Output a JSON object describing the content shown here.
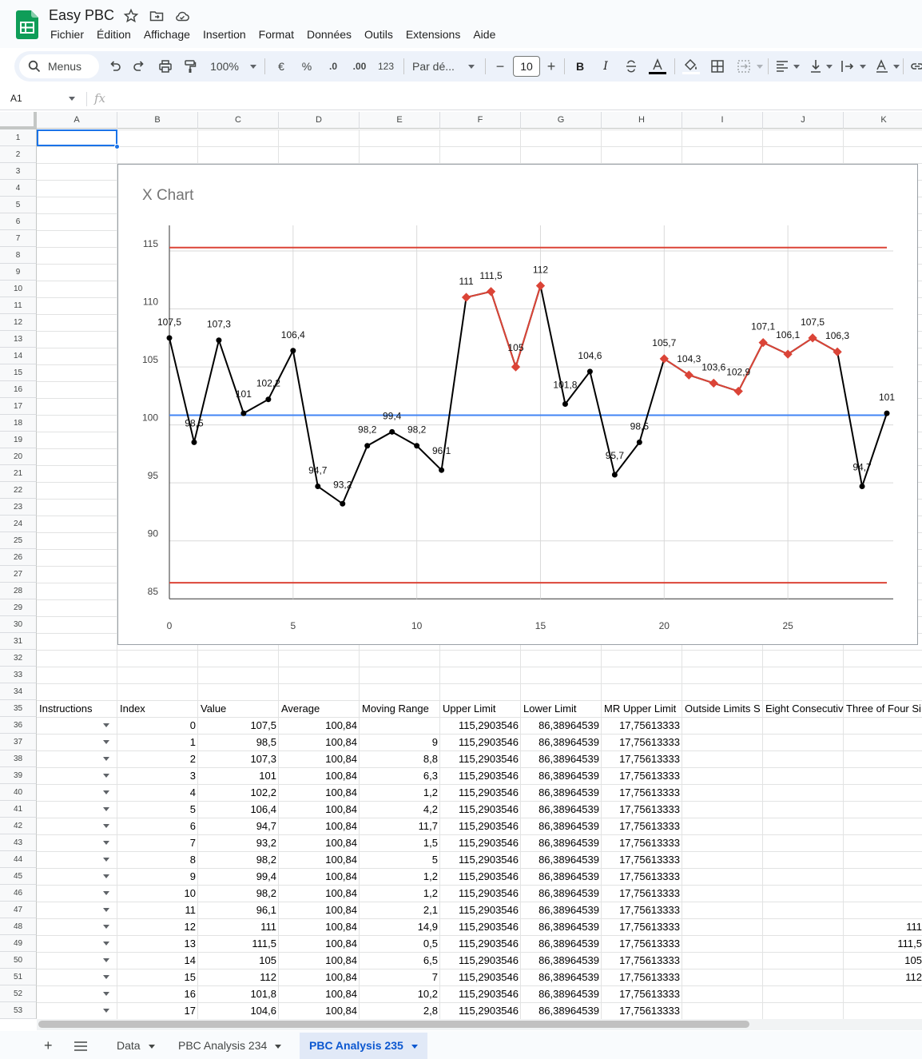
{
  "app": {
    "title": "Easy PBC",
    "menus": [
      "Fichier",
      "Édition",
      "Affichage",
      "Insertion",
      "Format",
      "Données",
      "Outils",
      "Extensions",
      "Aide"
    ]
  },
  "toolbar": {
    "search_label": "Menus",
    "zoom": "100%",
    "currency": "€",
    "percent": "%",
    "dec_decrease": ".0",
    "dec_increase": ".00",
    "number_format": "123",
    "font": "Par dé...",
    "font_size": "10",
    "bold": "B",
    "italic": "I"
  },
  "formula_bar": {
    "name_box": "A1",
    "fx": "fx"
  },
  "columns": [
    "A",
    "B",
    "C",
    "D",
    "E",
    "F",
    "G",
    "H",
    "I",
    "J",
    "K"
  ],
  "rows": [
    "1",
    "2",
    "3",
    "4",
    "5",
    "6",
    "7",
    "8",
    "9",
    "10",
    "11",
    "12",
    "13",
    "14",
    "15",
    "16",
    "17",
    "18",
    "19",
    "20",
    "21",
    "22",
    "23",
    "24",
    "25",
    "26",
    "27",
    "28",
    "29",
    "30",
    "31",
    "32",
    "33",
    "34",
    "35",
    "36",
    "37",
    "38",
    "39",
    "40",
    "41",
    "42",
    "43",
    "44",
    "45",
    "46",
    "47",
    "48",
    "49",
    "50",
    "51",
    "52",
    "53"
  ],
  "table": {
    "headers": [
      "Instructions",
      "Index",
      "Value",
      "Average",
      "Moving Range",
      "Upper Limit",
      "Lower Limit",
      "MR Upper Limit",
      "Outside Limits S",
      "Eight Consecutiv",
      "Three of Four Si"
    ],
    "rows": [
      [
        "",
        "0",
        "107,5",
        "100,84",
        "",
        "115,2903546",
        "86,38964539",
        "17,75613333",
        "",
        "",
        ""
      ],
      [
        "",
        "1",
        "98,5",
        "100,84",
        "9",
        "115,2903546",
        "86,38964539",
        "17,75613333",
        "",
        "",
        ""
      ],
      [
        "",
        "2",
        "107,3",
        "100,84",
        "8,8",
        "115,2903546",
        "86,38964539",
        "17,75613333",
        "",
        "",
        ""
      ],
      [
        "",
        "3",
        "101",
        "100,84",
        "6,3",
        "115,2903546",
        "86,38964539",
        "17,75613333",
        "",
        "",
        ""
      ],
      [
        "",
        "4",
        "102,2",
        "100,84",
        "1,2",
        "115,2903546",
        "86,38964539",
        "17,75613333",
        "",
        "",
        ""
      ],
      [
        "",
        "5",
        "106,4",
        "100,84",
        "4,2",
        "115,2903546",
        "86,38964539",
        "17,75613333",
        "",
        "",
        ""
      ],
      [
        "",
        "6",
        "94,7",
        "100,84",
        "11,7",
        "115,2903546",
        "86,38964539",
        "17,75613333",
        "",
        "",
        ""
      ],
      [
        "",
        "7",
        "93,2",
        "100,84",
        "1,5",
        "115,2903546",
        "86,38964539",
        "17,75613333",
        "",
        "",
        ""
      ],
      [
        "",
        "8",
        "98,2",
        "100,84",
        "5",
        "115,2903546",
        "86,38964539",
        "17,75613333",
        "",
        "",
        ""
      ],
      [
        "",
        "9",
        "99,4",
        "100,84",
        "1,2",
        "115,2903546",
        "86,38964539",
        "17,75613333",
        "",
        "",
        ""
      ],
      [
        "",
        "10",
        "98,2",
        "100,84",
        "1,2",
        "115,2903546",
        "86,38964539",
        "17,75613333",
        "",
        "",
        ""
      ],
      [
        "",
        "11",
        "96,1",
        "100,84",
        "2,1",
        "115,2903546",
        "86,38964539",
        "17,75613333",
        "",
        "",
        ""
      ],
      [
        "",
        "12",
        "111",
        "100,84",
        "14,9",
        "115,2903546",
        "86,38964539",
        "17,75613333",
        "",
        "",
        "111"
      ],
      [
        "",
        "13",
        "111,5",
        "100,84",
        "0,5",
        "115,2903546",
        "86,38964539",
        "17,75613333",
        "",
        "",
        "111,5"
      ],
      [
        "",
        "14",
        "105",
        "100,84",
        "6,5",
        "115,2903546",
        "86,38964539",
        "17,75613333",
        "",
        "",
        "105"
      ],
      [
        "",
        "15",
        "112",
        "100,84",
        "7",
        "115,2903546",
        "86,38964539",
        "17,75613333",
        "",
        "",
        "112"
      ],
      [
        "",
        "16",
        "101,8",
        "100,84",
        "10,2",
        "115,2903546",
        "86,38964539",
        "17,75613333",
        "",
        "",
        ""
      ],
      [
        "",
        "17",
        "104,6",
        "100,84",
        "2,8",
        "115,2903546",
        "86,38964539",
        "17,75613333",
        "",
        "",
        ""
      ]
    ]
  },
  "sheets": {
    "tabs": [
      "Data",
      "PBC Analysis 234",
      "PBC Analysis 235"
    ],
    "active": "PBC Analysis 235"
  },
  "colors": {
    "value_line": "#000000",
    "highlight_points": "#db4437",
    "limit_lines": "#db4437",
    "average_line": "#4285f4",
    "selection": "#1a73e8"
  },
  "chart_data": {
    "type": "line",
    "title": "X Chart",
    "xlabel": "",
    "ylabel": "",
    "x": [
      0,
      1,
      2,
      3,
      4,
      5,
      6,
      7,
      8,
      9,
      10,
      11,
      12,
      13,
      14,
      15,
      16,
      17,
      18,
      19,
      20,
      21,
      22,
      23,
      24,
      25,
      26,
      27,
      28,
      29
    ],
    "values": [
      107.5,
      98.5,
      107.3,
      101,
      102.2,
      106.4,
      94.7,
      93.2,
      98.2,
      99.4,
      98.2,
      96.1,
      111,
      111.5,
      105,
      112,
      101.8,
      104.6,
      95.7,
      98.5,
      105.7,
      104.3,
      103.6,
      102.9,
      107.1,
      106.1,
      107.5,
      106.3,
      94.7,
      101
    ],
    "value_labels": [
      "107,5",
      "98,5",
      "107,3",
      "101",
      "102,2",
      "106,4",
      "94,7",
      "93,2",
      "98,2",
      "99,4",
      "98,2",
      "96,1",
      "111",
      "111,5",
      "105",
      "112",
      "101,8",
      "104,6",
      "95,7",
      "98,5",
      "105,7",
      "104,3",
      "103,6",
      "102,9",
      "107,1",
      "106,1",
      "107,5",
      "106,3",
      "94,7",
      "101"
    ],
    "highlight_ranges": [
      [
        12,
        15
      ],
      [
        20,
        27
      ]
    ],
    "upper_limit": 115.2903546,
    "lower_limit": 86.38964539,
    "average": 100.84,
    "xlim": [
      0,
      29
    ],
    "ylim": [
      83.5,
      117
    ],
    "xticks": [
      0,
      5,
      10,
      15,
      20,
      25
    ],
    "yticks": [
      85,
      90,
      95,
      100,
      105,
      110,
      115
    ],
    "grid": true,
    "legend": "none"
  }
}
